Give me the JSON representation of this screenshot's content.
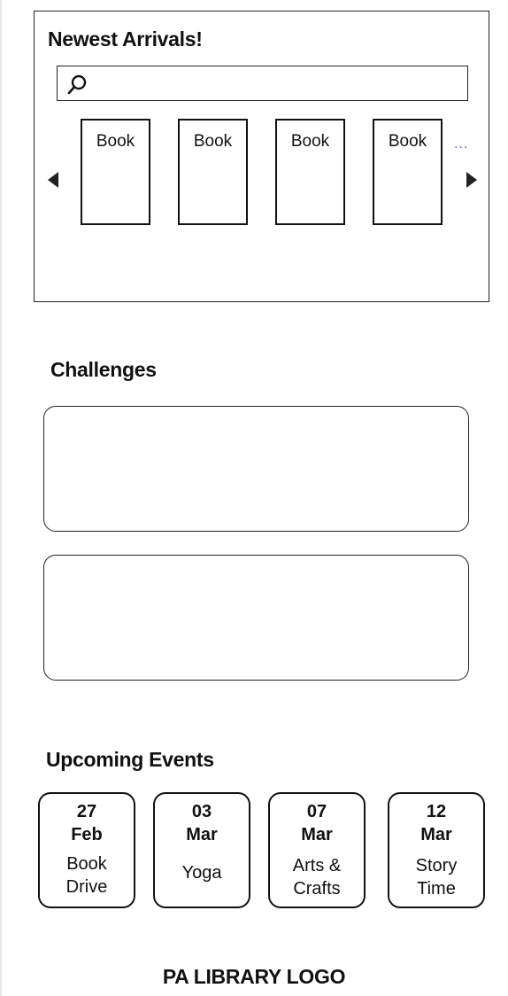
{
  "arrivals": {
    "title": "Newest Arrivals!",
    "search": {
      "value": "",
      "placeholder": ""
    },
    "books": [
      {
        "label": "Book"
      },
      {
        "label": "Book"
      },
      {
        "label": "Book"
      },
      {
        "label": "Book"
      }
    ],
    "more_indicator": "...",
    "icons": {
      "search": "search-icon",
      "prev": "arrow-left-icon",
      "next": "arrow-right-icon"
    }
  },
  "challenges": {
    "title": "Challenges"
  },
  "events": {
    "title": "Upcoming Events",
    "items": [
      {
        "day": "27",
        "month": "Feb",
        "name": "Book\nDrive"
      },
      {
        "day": "03",
        "month": "Mar",
        "name": "Yoga"
      },
      {
        "day": "07",
        "month": "Mar",
        "name": "Arts &\nCrafts"
      },
      {
        "day": "12",
        "month": "Mar",
        "name": "Story\nTime"
      }
    ]
  },
  "footer": {
    "logo_text": "PA LIBRARY LOGO"
  },
  "colors": {
    "text": "#111111",
    "border": "#222222",
    "accent_dots": "#7b4fd6"
  }
}
